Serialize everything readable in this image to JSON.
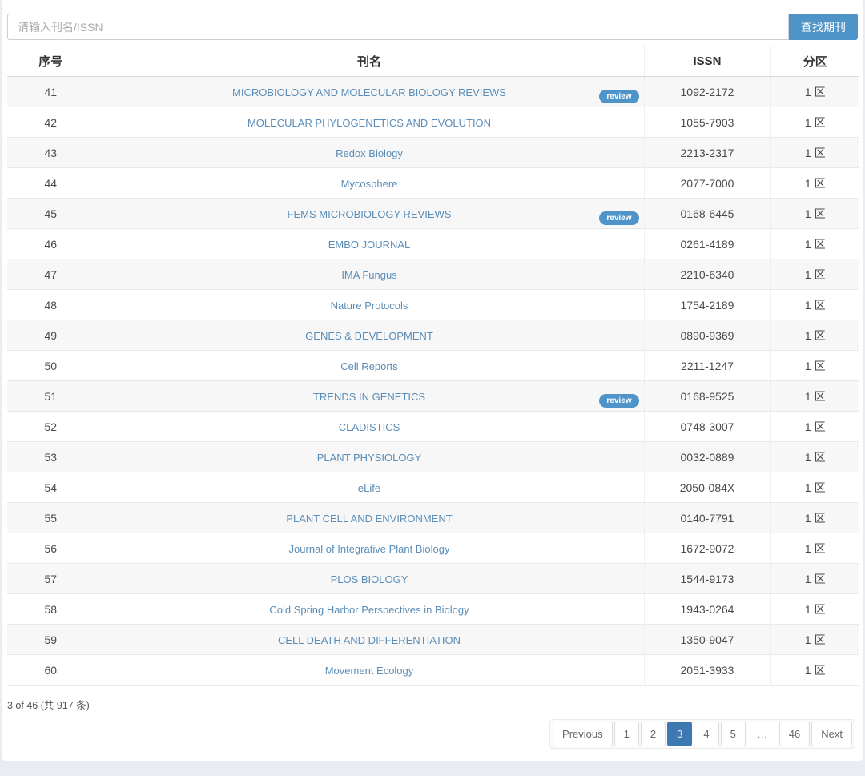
{
  "search": {
    "placeholder": "请输入刊名/ISSN",
    "button_label": "查找期刊"
  },
  "badge_label": "review",
  "table": {
    "headers": {
      "index": "序号",
      "name": "刊名",
      "issn": "ISSN",
      "zone": "分区"
    },
    "rows": [
      {
        "index": "41",
        "name": "MICROBIOLOGY AND MOLECULAR BIOLOGY REVIEWS",
        "review": true,
        "issn": "1092-2172",
        "zone": "1 区"
      },
      {
        "index": "42",
        "name": "MOLECULAR PHYLOGENETICS AND EVOLUTION",
        "review": false,
        "issn": "1055-7903",
        "zone": "1 区"
      },
      {
        "index": "43",
        "name": "Redox Biology",
        "review": false,
        "issn": "2213-2317",
        "zone": "1 区"
      },
      {
        "index": "44",
        "name": "Mycosphere",
        "review": false,
        "issn": "2077-7000",
        "zone": "1 区"
      },
      {
        "index": "45",
        "name": "FEMS MICROBIOLOGY REVIEWS",
        "review": true,
        "issn": "0168-6445",
        "zone": "1 区"
      },
      {
        "index": "46",
        "name": "EMBO JOURNAL",
        "review": false,
        "issn": "0261-4189",
        "zone": "1 区"
      },
      {
        "index": "47",
        "name": "IMA Fungus",
        "review": false,
        "issn": "2210-6340",
        "zone": "1 区"
      },
      {
        "index": "48",
        "name": "Nature Protocols",
        "review": false,
        "issn": "1754-2189",
        "zone": "1 区"
      },
      {
        "index": "49",
        "name": "GENES & DEVELOPMENT",
        "review": false,
        "issn": "0890-9369",
        "zone": "1 区"
      },
      {
        "index": "50",
        "name": "Cell Reports",
        "review": false,
        "issn": "2211-1247",
        "zone": "1 区"
      },
      {
        "index": "51",
        "name": "TRENDS IN GENETICS",
        "review": true,
        "issn": "0168-9525",
        "zone": "1 区"
      },
      {
        "index": "52",
        "name": "CLADISTICS",
        "review": false,
        "issn": "0748-3007",
        "zone": "1 区"
      },
      {
        "index": "53",
        "name": "PLANT PHYSIOLOGY",
        "review": false,
        "issn": "0032-0889",
        "zone": "1 区"
      },
      {
        "index": "54",
        "name": "eLife",
        "review": false,
        "issn": "2050-084X",
        "zone": "1 区"
      },
      {
        "index": "55",
        "name": "PLANT CELL AND ENVIRONMENT",
        "review": false,
        "issn": "0140-7791",
        "zone": "1 区"
      },
      {
        "index": "56",
        "name": "Journal of Integrative Plant Biology",
        "review": false,
        "issn": "1672-9072",
        "zone": "1 区"
      },
      {
        "index": "57",
        "name": "PLOS BIOLOGY",
        "review": false,
        "issn": "1544-9173",
        "zone": "1 区"
      },
      {
        "index": "58",
        "name": "Cold Spring Harbor Perspectives in Biology",
        "review": false,
        "issn": "1943-0264",
        "zone": "1 区"
      },
      {
        "index": "59",
        "name": "CELL DEATH AND DIFFERENTIATION",
        "review": false,
        "issn": "1350-9047",
        "zone": "1 区"
      },
      {
        "index": "60",
        "name": "Movement Ecology",
        "review": false,
        "issn": "2051-3933",
        "zone": "1 区"
      }
    ]
  },
  "footer": {
    "summary": "3 of 46 (共 917 条)"
  },
  "pagination": {
    "prev_label": "Previous",
    "next_label": "Next",
    "pages": [
      "1",
      "2",
      "3",
      "4",
      "5",
      "…",
      "46"
    ],
    "active_page": "3",
    "ellipsis": "…"
  },
  "colors": {
    "accent_blue": "#4f94c8",
    "active_page_blue": "#3e78b0",
    "link_blue": "#5a8db8",
    "page_background": "#e9ecf2",
    "stripe_gray": "#f7f7f7"
  }
}
